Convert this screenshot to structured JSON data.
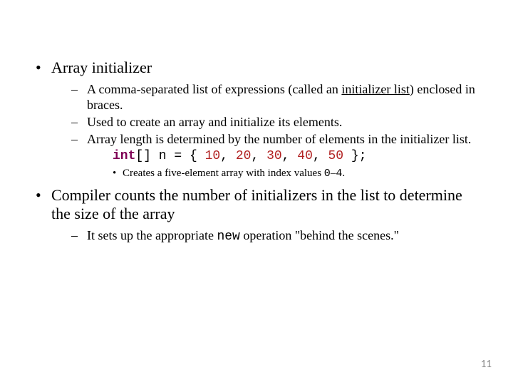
{
  "bullets": {
    "dot": "•",
    "dash": "–",
    "dot3": "•"
  },
  "b1": {
    "text": "Array initializer",
    "sub": {
      "s1a": "A comma-separated list of expressions (called an ",
      "s1u": "initializer list",
      "s1b": ") enclosed in braces.",
      "s2": "Used to create an array and initialize its elements.",
      "s3": "Array length is determined by the number of elements in the initializer list."
    },
    "code": {
      "kw": "int",
      "mid1": "[] n = { ",
      "n1": "10",
      "c1": ", ",
      "n2": "20",
      "c2": ", ",
      "n3": "30",
      "c3": ", ",
      "n4": "40",
      "c4": ", ",
      "n5": "50",
      "end": " };"
    },
    "sub3a": "Creates a five-element array with index values ",
    "sub3m": "0",
    "sub3b": "–",
    "sub3m2": "4",
    "sub3c": "."
  },
  "b2": {
    "text": "Compiler counts the number of initializers in the list to determine the size of the array",
    "sub": {
      "s1a": "It sets up the appropriate ",
      "s1m": "new",
      "s1b": " operation \"behind the scenes.\""
    }
  },
  "page": "11"
}
